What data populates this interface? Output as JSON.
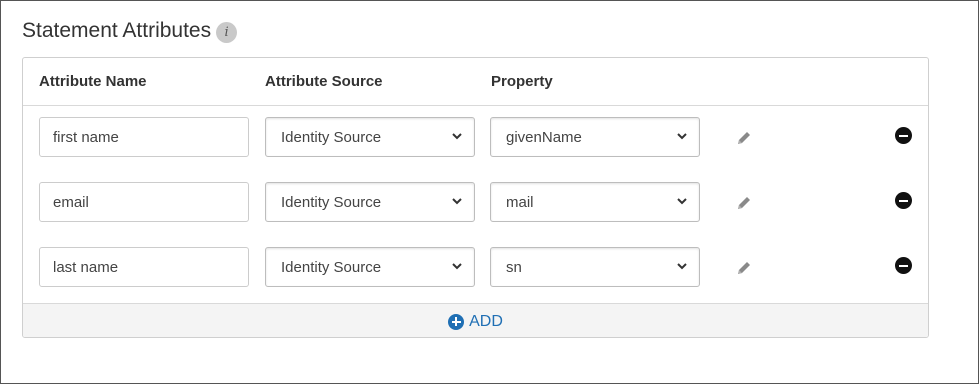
{
  "section": {
    "title": "Statement Attributes",
    "info_icon": "info-icon",
    "info_glyph": "i"
  },
  "table": {
    "headers": {
      "attribute_name": "Attribute Name",
      "attribute_source": "Attribute Source",
      "property": "Property"
    },
    "rows": [
      {
        "name": "first name",
        "source": "Identity Source",
        "property": "givenName"
      },
      {
        "name": "email",
        "source": "Identity Source",
        "property": "mail"
      },
      {
        "name": "last name",
        "source": "Identity Source",
        "property": "sn"
      }
    ]
  },
  "actions": {
    "add_label": "ADD",
    "edit_icon": "pencil-icon",
    "remove_icon": "minus-circle-icon"
  },
  "colors": {
    "accent": "#1f6fb4",
    "remove": "#111111",
    "pencil": "#8a8a8a"
  }
}
